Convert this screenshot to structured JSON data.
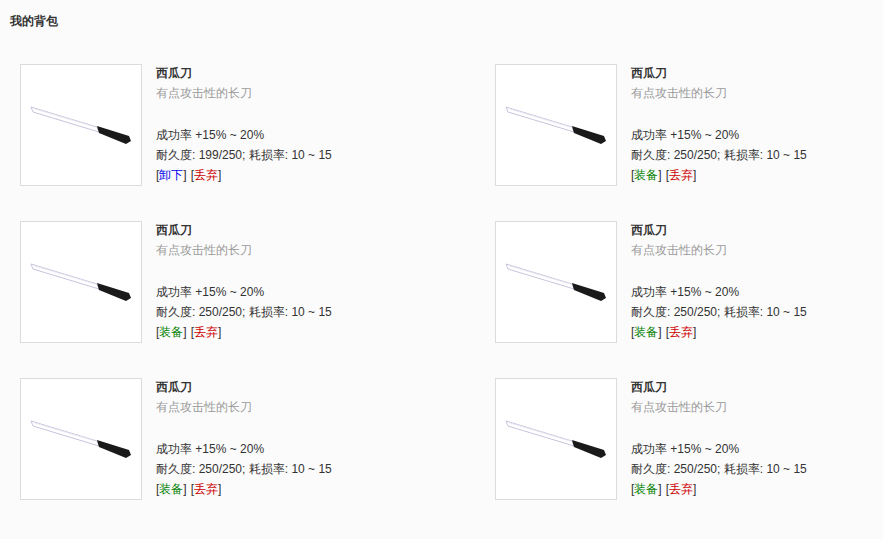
{
  "title": "我的背包",
  "bracket_open": "[",
  "bracket_close": "]",
  "items": [
    {
      "name": "西瓜刀",
      "description": "有点攻击性的长刀",
      "stats": [
        "成功率 +15% ~ 20%",
        "耐久度: 199/250; 耗损率: 10 ~ 15"
      ],
      "equipped": true,
      "actions": [
        {
          "label": "卸下",
          "kind": "unequip"
        },
        {
          "label": "丢弃",
          "kind": "discard"
        }
      ]
    },
    {
      "name": "西瓜刀",
      "description": "有点攻击性的长刀",
      "stats": [
        "成功率 +15% ~ 20%",
        "耐久度: 250/250; 耗损率: 10 ~ 15"
      ],
      "equipped": false,
      "actions": [
        {
          "label": "装备",
          "kind": "equip"
        },
        {
          "label": "丢弃",
          "kind": "discard"
        }
      ]
    },
    {
      "name": "西瓜刀",
      "description": "有点攻击性的长刀",
      "stats": [
        "成功率 +15% ~ 20%",
        "耐久度: 250/250; 耗损率: 10 ~ 15"
      ],
      "equipped": false,
      "actions": [
        {
          "label": "装备",
          "kind": "equip"
        },
        {
          "label": "丢弃",
          "kind": "discard"
        }
      ]
    },
    {
      "name": "西瓜刀",
      "description": "有点攻击性的长刀",
      "stats": [
        "成功率 +15% ~ 20%",
        "耐久度: 250/250; 耗损率: 10 ~ 15"
      ],
      "equipped": false,
      "actions": [
        {
          "label": "装备",
          "kind": "equip"
        },
        {
          "label": "丢弃",
          "kind": "discard"
        }
      ]
    },
    {
      "name": "西瓜刀",
      "description": "有点攻击性的长刀",
      "stats": [
        "成功率 +15% ~ 20%",
        "耐久度: 250/250; 耗损率: 10 ~ 15"
      ],
      "equipped": false,
      "actions": [
        {
          "label": "装备",
          "kind": "equip"
        },
        {
          "label": "丢弃",
          "kind": "discard"
        }
      ]
    },
    {
      "name": "西瓜刀",
      "description": "有点攻击性的长刀",
      "stats": [
        "成功率 +15% ~ 20%",
        "耐久度: 250/250; 耗损率: 10 ~ 15"
      ],
      "equipped": false,
      "actions": [
        {
          "label": "装备",
          "kind": "equip"
        },
        {
          "label": "丢弃",
          "kind": "discard"
        }
      ]
    }
  ]
}
